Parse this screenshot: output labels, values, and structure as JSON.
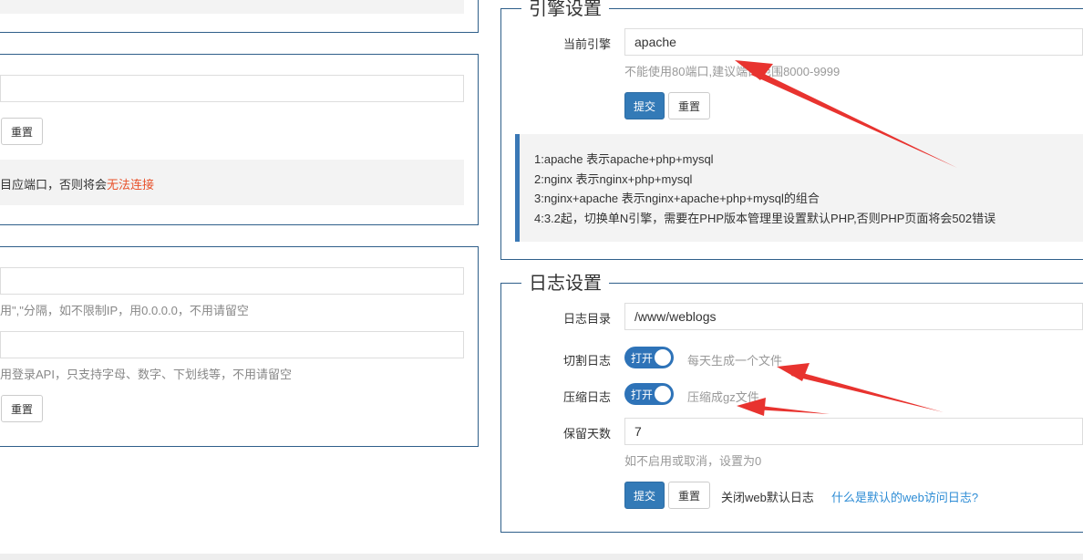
{
  "left": {
    "partial_notice_prefix": "目应端口，否则将会",
    "partial_notice_warn": "无法连接",
    "reset_label": "重置",
    "ip_help_partial": "用\",\"分隔，如不限制IP，用0.0.0.0，不用请留空",
    "api_help_partial": "用登录API，只支持字母、数字、下划线等，不用请留空"
  },
  "engine": {
    "legend": "引擎设置",
    "current_label": "当前引擎",
    "current_value": "apache",
    "help": "不能使用80端口,建议端口范围8000-9999",
    "submit_label": "提交",
    "reset_label": "重置",
    "tips": [
      "1:apache    表示apache+php+mysql",
      "2:nginx     表示nginx+php+mysql",
      "3:nginx+apache 表示nginx+apache+php+mysql的组合",
      "4:3.2起，切换单N引擎，需要在PHP版本管理里设置默认PHP,否则PHP页面将会502错误"
    ]
  },
  "log": {
    "legend": "日志设置",
    "dir_label": "日志目录",
    "dir_value": "/www/weblogs",
    "cut_label": "切割日志",
    "cut_switch": "打开",
    "cut_help": "每天生成一个文件",
    "compress_label": "压缩日志",
    "compress_switch": "打开",
    "compress_help": "压缩成gz文件",
    "keep_label": "保留天数",
    "keep_value": "7",
    "keep_help": "如不启用或取消，设置为0",
    "submit_label": "提交",
    "reset_label": "重置",
    "close_default_log": "关闭web默认日志",
    "what_link": "什么是默认的web访问日志?"
  },
  "colors": {
    "primary": "#337ab7",
    "border": "#2f5f8a",
    "annotation_red": "#e8332f",
    "link": "#2d8cd5",
    "warn": "#e8512a"
  }
}
